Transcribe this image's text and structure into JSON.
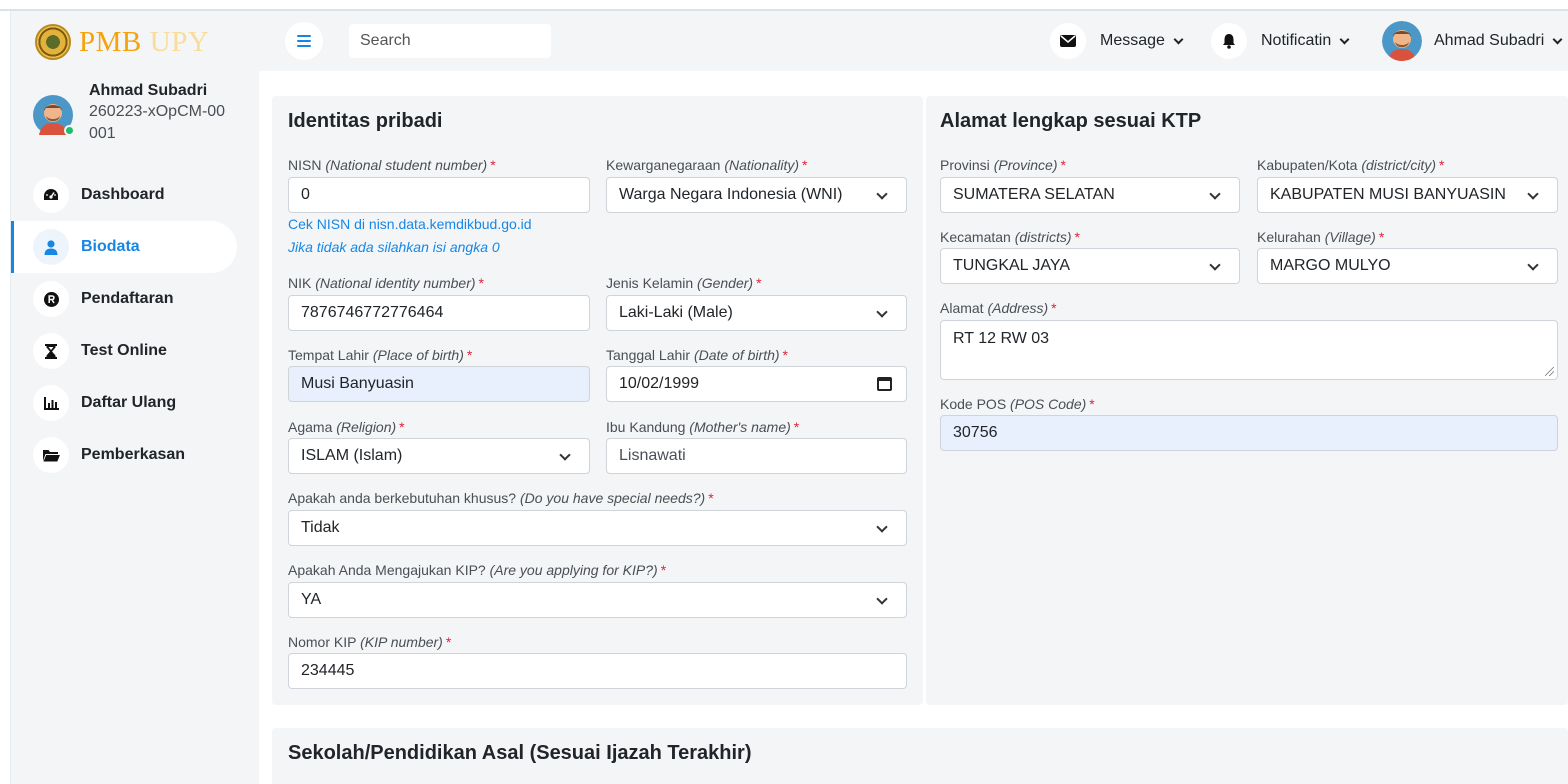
{
  "app": {
    "logo_primary": "PMB",
    "logo_secondary": "UPY"
  },
  "header": {
    "search_placeholder": "Search",
    "message_label": "Message",
    "notification_label": "Notificatin",
    "user_name": "Ahmad Subadri"
  },
  "sidebar": {
    "profile": {
      "name": "Ahmad Subadri",
      "id": "260223-xOpCM-00001"
    },
    "items": [
      {
        "label": "Dashboard",
        "icon": "gauge-icon",
        "active": false
      },
      {
        "label": "Biodata",
        "icon": "user-icon",
        "active": true
      },
      {
        "label": "Pendaftaran",
        "icon": "registered-icon",
        "active": false
      },
      {
        "label": "Test Online",
        "icon": "hourglass-icon",
        "active": false
      },
      {
        "label": "Daftar Ulang",
        "icon": "chart-icon",
        "active": false
      },
      {
        "label": "Pemberkasan",
        "icon": "folder-open-icon",
        "active": false
      }
    ]
  },
  "identitas": {
    "title": "Identitas pribadi",
    "nisn": {
      "label": "NISN",
      "hint": "(National student number)",
      "value": "0",
      "help1": "Cek NISN di nisn.data.kemdikbud.go.id",
      "help2": "Jika tidak ada silahkan isi angka 0"
    },
    "kewarganegaraan": {
      "label": "Kewarganegaraan",
      "hint": "(Nationality)",
      "value": "Warga Negara Indonesia (WNI)"
    },
    "nik": {
      "label": "NIK",
      "hint": "(National identity number)",
      "value": "7876746772776464"
    },
    "gender": {
      "label": "Jenis Kelamin",
      "hint": "(Gender)",
      "value": "Laki-Laki (Male)"
    },
    "tempat_lahir": {
      "label": "Tempat Lahir",
      "hint": "(Place of birth)",
      "value": "Musi Banyuasin"
    },
    "tanggal_lahir": {
      "label": "Tanggal Lahir",
      "hint": "(Date of birth)",
      "value": "10/02/1999"
    },
    "agama": {
      "label": "Agama",
      "hint": "(Religion)",
      "value": "ISLAM (Islam)"
    },
    "ibu": {
      "label": "Ibu Kandung",
      "hint": "(Mother's name)",
      "value": "Lisnawati"
    },
    "kebutuhan": {
      "label": "Apakah anda berkebutuhan khusus?",
      "hint": "(Do you have special needs?)",
      "value": "Tidak"
    },
    "kip": {
      "label": "Apakah Anda Mengajukan KIP?",
      "hint": "(Are you applying for KIP?)",
      "value": "YA"
    },
    "nomor_kip": {
      "label": "Nomor KIP",
      "hint": "(KIP number)",
      "value": "234445"
    }
  },
  "alamat": {
    "title": "Alamat lengkap sesuai KTP",
    "provinsi": {
      "label": "Provinsi",
      "hint": "(Province)",
      "value": "SUMATERA SELATAN"
    },
    "kabupaten": {
      "label": "Kabupaten/Kota",
      "hint": "(district/city)",
      "value": "KABUPATEN MUSI BANYUASIN"
    },
    "kecamatan": {
      "label": "Kecamatan",
      "hint": "(districts)",
      "value": "TUNGKAL JAYA"
    },
    "kelurahan": {
      "label": "Kelurahan",
      "hint": "(Village)",
      "value": "MARGO MULYO"
    },
    "address": {
      "label": "Alamat",
      "hint": "(Address)",
      "value": "RT 12 RW 03"
    },
    "pos": {
      "label": "Kode POS",
      "hint": "(POS Code)",
      "value": "30756"
    }
  },
  "sekolah": {
    "title": "Sekolah/Pendidikan Asal (Sesuai Ijazah Terakhir)"
  },
  "required_mark": "*"
}
